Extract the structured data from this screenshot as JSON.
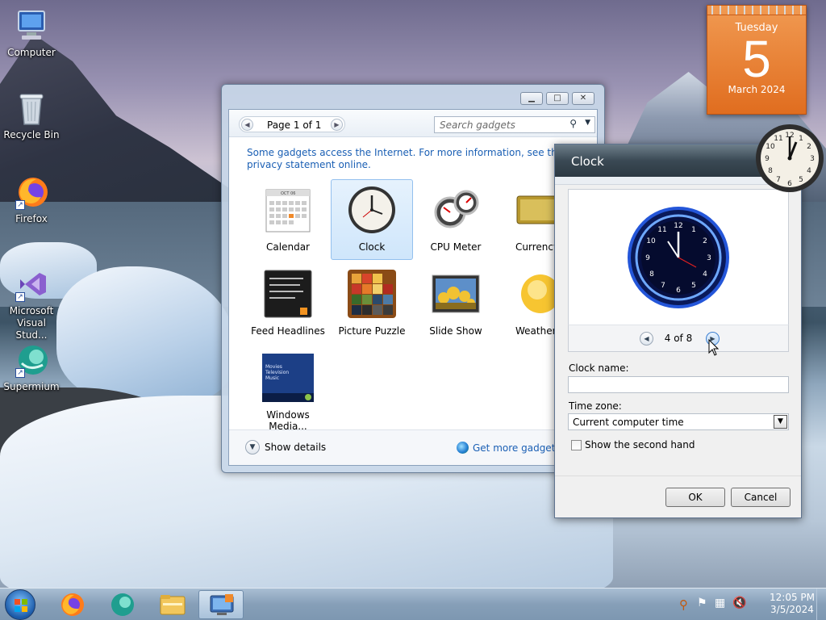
{
  "desktop": {
    "icons": [
      {
        "label": "Computer"
      },
      {
        "label": "Recycle Bin"
      },
      {
        "label": "Firefox"
      },
      {
        "label": "Microsoft Visual Stud..."
      },
      {
        "label": "Supermium"
      }
    ]
  },
  "calendar_gadget": {
    "weekday": "Tuesday",
    "day": "5",
    "month_year": "March 2024"
  },
  "gadget_gallery": {
    "page_label": "Page 1 of 1",
    "search_placeholder": "Search gadgets",
    "info_text": "Some gadgets access the Internet.  For more information, see the privacy statement online.",
    "gadgets": [
      {
        "label": "Calendar"
      },
      {
        "label": "Clock"
      },
      {
        "label": "CPU Meter"
      },
      {
        "label": "Currency"
      },
      {
        "label": "Feed Headlines"
      },
      {
        "label": "Picture Puzzle"
      },
      {
        "label": "Slide Show"
      },
      {
        "label": "Weather"
      },
      {
        "label": "Windows Media..."
      }
    ],
    "calendar_thumb_month": "OCT 06",
    "media_thumb_lines": [
      "Movies",
      "Television",
      "Music"
    ],
    "show_details": "Show details",
    "get_more": "Get more gadgets online"
  },
  "clock_dialog": {
    "title": "Clock",
    "page_indicator": "4 of 8",
    "clock_name_label": "Clock name:",
    "clock_name_value": "",
    "time_zone_label": "Time zone:",
    "time_zone_value": "Current computer time",
    "second_hand_label": "Show the second hand",
    "second_hand_checked": false,
    "ok": "OK",
    "cancel": "Cancel"
  },
  "taskbar": {
    "time": "12:05 PM",
    "date": "3/5/2024"
  }
}
